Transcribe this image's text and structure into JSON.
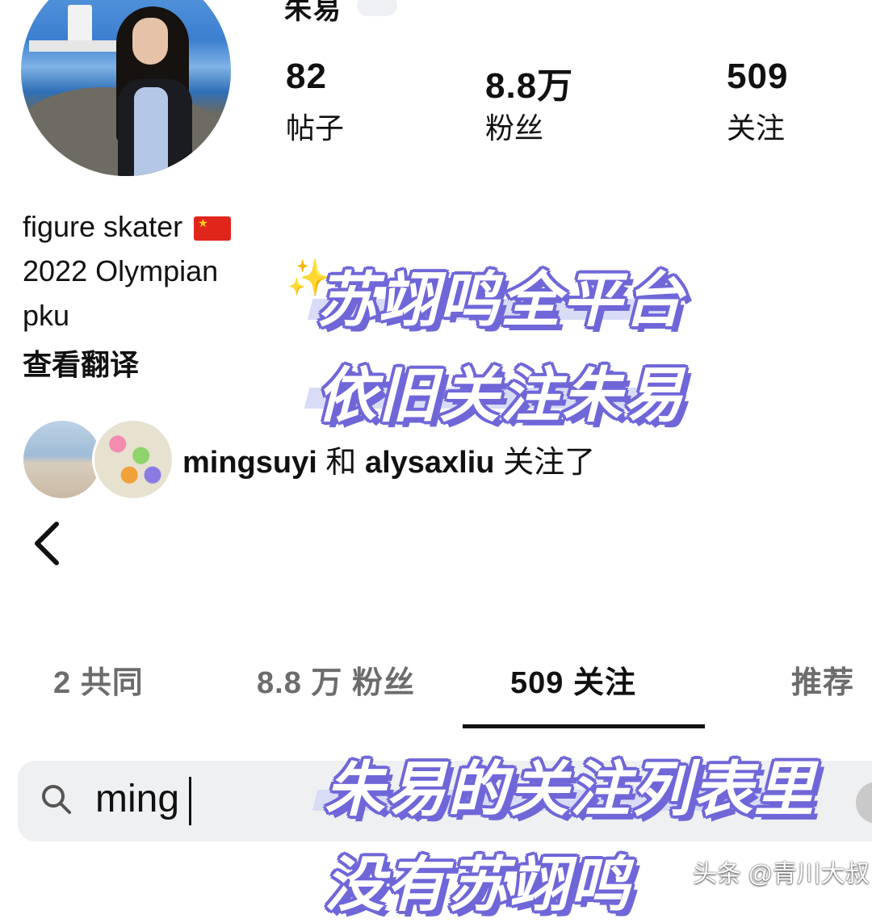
{
  "profile": {
    "name": "朱易",
    "stats": [
      {
        "value": "82",
        "label": "帖子"
      },
      {
        "value": "8.8万",
        "label": "粉丝"
      },
      {
        "value": "509",
        "label": "关注"
      }
    ],
    "bio": [
      "figure skater",
      "2022 Olympian",
      "pku"
    ],
    "translate_label": "查看翻译",
    "followed_by": {
      "user1": "mingsuyi",
      "connector": "和",
      "user2": "alysaxliu",
      "suffix": "关注了"
    }
  },
  "captions": {
    "line1": "苏翊鸣全平台",
    "line2": "依旧关注朱易",
    "line3": "朱易的关注列表里",
    "line4": "没有苏翊鸣"
  },
  "tabs": [
    {
      "label": "2 共同"
    },
    {
      "label": "8.8 万 粉丝"
    },
    {
      "label": "509 关注",
      "active": true
    },
    {
      "label": "推荐"
    }
  ],
  "search": {
    "value": "ming"
  },
  "watermark": "头条 @青川大叔",
  "colors": {
    "caption_outline": "#6f67d8",
    "caption_band": "#d9dcf7",
    "search_bg": "#eff0f2",
    "flag_red": "#e0261b"
  }
}
